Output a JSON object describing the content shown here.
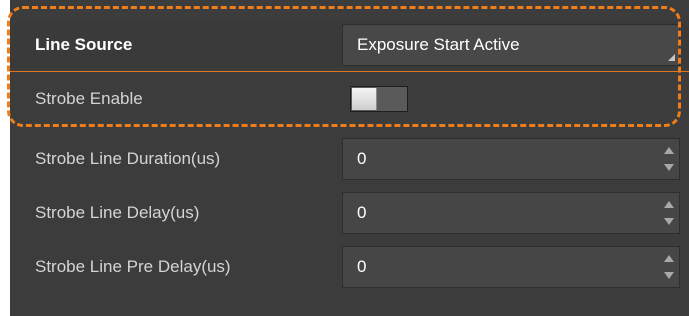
{
  "properties": {
    "line_source": {
      "label": "Line Source",
      "value": "Exposure Start Active"
    },
    "strobe_enable": {
      "label": "Strobe Enable",
      "state": "off"
    },
    "strobe_line_duration": {
      "label": "Strobe Line Duration(us)",
      "value": "0"
    },
    "strobe_line_delay": {
      "label": "Strobe Line Delay(us)",
      "value": "0"
    },
    "strobe_line_pre_delay": {
      "label": "Strobe Line Pre Delay(us)",
      "value": "0"
    }
  },
  "colors": {
    "panel_background": "#3c3c3c",
    "highlight": "#ee7d1a",
    "text": "#d4d4d4"
  },
  "icons": {
    "dropdown": "dropdown-arrow-icon",
    "spin_up": "spin-up-icon",
    "spin_down": "spin-down-icon"
  }
}
